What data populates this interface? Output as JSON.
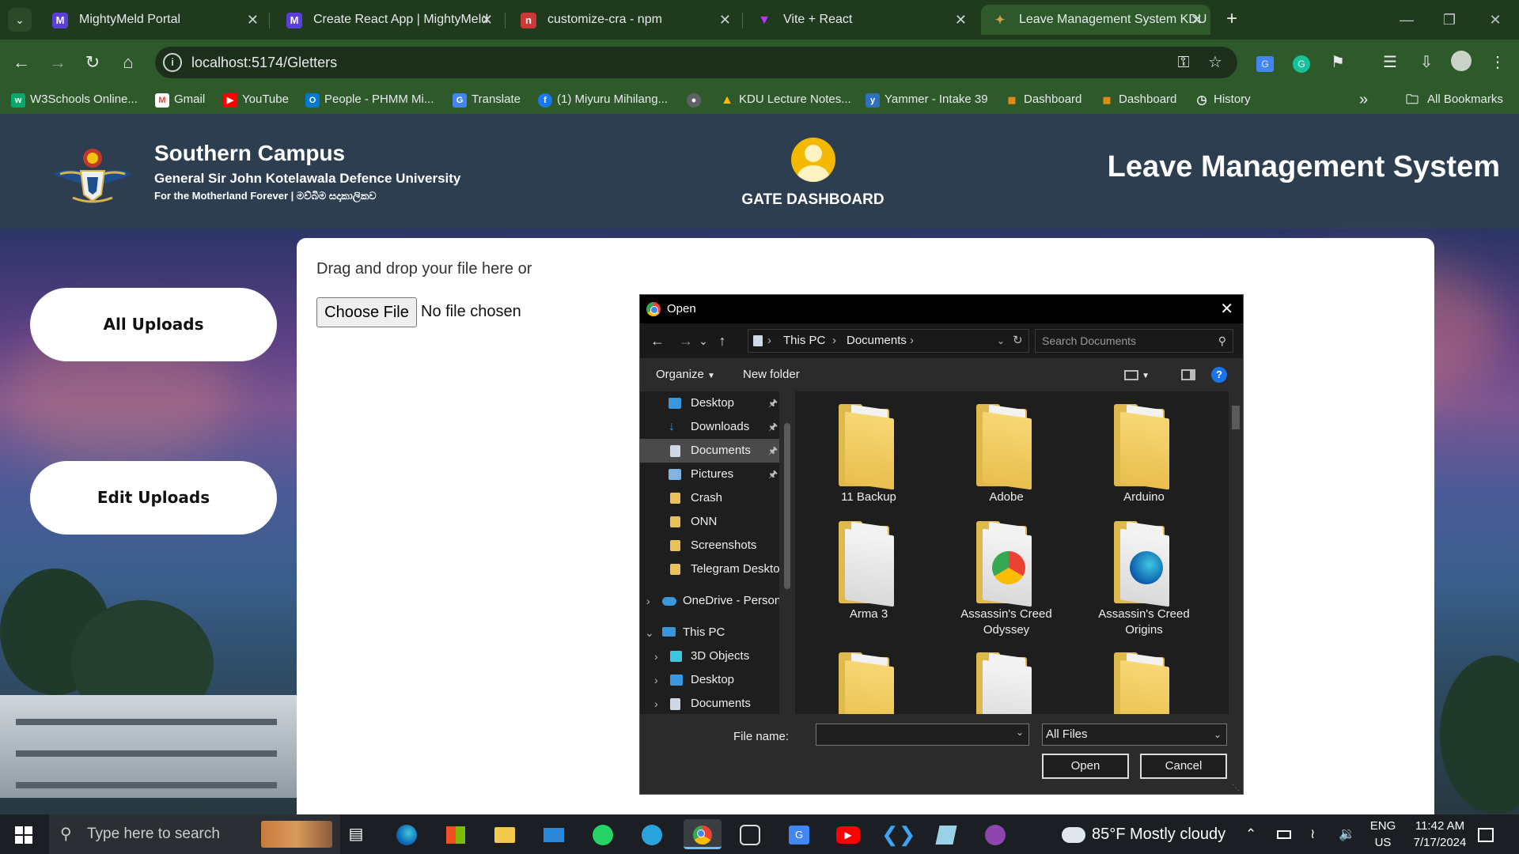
{
  "browser": {
    "tabs": [
      {
        "title": "MightyMeld Portal"
      },
      {
        "title": "Create React App | MightyMeld"
      },
      {
        "title": "customize-cra - npm"
      },
      {
        "title": "Vite + React"
      },
      {
        "title": "Leave Management System KDU"
      }
    ],
    "url": "localhost:5174/Gletters",
    "bookmarks": [
      {
        "label": "W3Schools Online..."
      },
      {
        "label": "Gmail"
      },
      {
        "label": "YouTube"
      },
      {
        "label": "People - PHMM Mi..."
      },
      {
        "label": "Translate"
      },
      {
        "label": "(1) Miyuru Mihilang..."
      },
      {
        "label": "KDU Lecture Notes..."
      },
      {
        "label": "Yammer - Intake 39"
      },
      {
        "label": "Dashboard"
      },
      {
        "label": "Dashboard"
      },
      {
        "label": "History"
      },
      {
        "label": "All Bookmarks"
      }
    ]
  },
  "header": {
    "campus": "Southern Campus",
    "university": "General Sir John Kotelawala Defence University",
    "motto": "For the Motherland Forever | මව්බිම සදාකාලිකව",
    "dashboard_label": "GATE DASHBOARD",
    "system_title": "Leave Management System"
  },
  "sidebar": {
    "all_uploads": "All Uploads",
    "edit_uploads": "Edit Uploads"
  },
  "upload": {
    "drop_text": "Drag and drop your file here or",
    "choose_button": "Choose File",
    "status": "No file chosen"
  },
  "dialog": {
    "title": "Open",
    "breadcrumb": [
      "This PC",
      "Documents"
    ],
    "search_placeholder": "Search Documents",
    "organize": "Organize",
    "new_folder": "New folder",
    "tree": [
      {
        "label": "Desktop",
        "pinned": true
      },
      {
        "label": "Downloads",
        "pinned": true
      },
      {
        "label": "Documents",
        "pinned": true,
        "selected": true
      },
      {
        "label": "Pictures",
        "pinned": true
      },
      {
        "label": "Crash"
      },
      {
        "label": "ONN"
      },
      {
        "label": "Screenshots"
      },
      {
        "label": "Telegram Desktop"
      },
      {
        "label": "OneDrive - Person"
      },
      {
        "label": "This PC"
      },
      {
        "label": "3D Objects"
      },
      {
        "label": "Desktop"
      },
      {
        "label": "Documents"
      }
    ],
    "files": [
      {
        "name": "11 Backup"
      },
      {
        "name": "Adobe"
      },
      {
        "name": "Arduino"
      },
      {
        "name": "Arma 3"
      },
      {
        "name": "Assassin's Creed Odyssey"
      },
      {
        "name": "Assassin's Creed Origins"
      }
    ],
    "file_name_label": "File name:",
    "file_name_value": "",
    "file_type": "All Files",
    "open_button": "Open",
    "cancel_button": "Cancel"
  },
  "taskbar": {
    "search_placeholder": "Type here to search",
    "weather": "85°F  Mostly cloudy",
    "lang_top": "ENG",
    "lang_bottom": "US",
    "time": "11:42 AM",
    "date": "7/17/2024"
  }
}
